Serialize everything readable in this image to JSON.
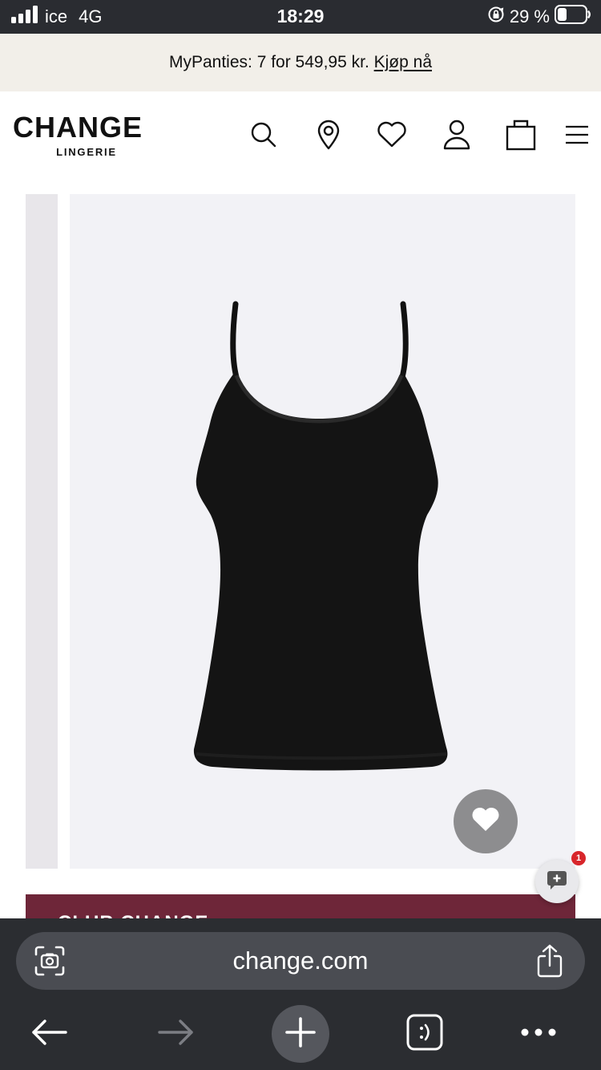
{
  "status_bar": {
    "carrier": "ice",
    "network": "4G",
    "time": "18:29",
    "battery_percent": "29 %",
    "icons": [
      "signal-icon",
      "rotation-lock-icon",
      "battery-icon"
    ]
  },
  "promo": {
    "text": "MyPanties: 7 for 549,95 kr.",
    "link": "Kjøp nå"
  },
  "header": {
    "logo_main": "CHANGE",
    "logo_sub": "LINGERIE",
    "icons": [
      "search-icon",
      "store-locator-icon",
      "wishlist-heart-icon",
      "account-icon",
      "shopping-bag-icon",
      "menu-icon"
    ]
  },
  "product": {
    "image_subject": "black camisole top",
    "favorite_icon": "heart-icon"
  },
  "chat": {
    "badge_count": "1",
    "icon": "chat-icon"
  },
  "banner": {
    "text": "CLUB CHANGE",
    "color": "#6e2639"
  },
  "browser": {
    "url": "change.com",
    "icons": [
      "visual-lookup-icon",
      "share-icon",
      "back-arrow-icon",
      "forward-arrow-icon",
      "new-tab-plus-icon",
      "tabs-icon",
      "more-icon"
    ]
  },
  "colors": {
    "status_bar_bg": "#2a2c31",
    "promo_bg": "#f2efe9",
    "product_bg": "#f2f2f6",
    "banner_bg": "#6e2639",
    "browser_bar_bg": "#2b2d31"
  }
}
